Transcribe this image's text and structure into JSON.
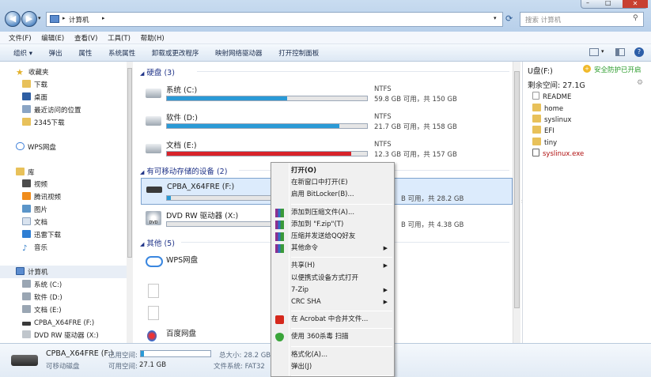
{
  "window": {
    "partial_title": "Windows...",
    "breadcrumb": "计算机",
    "search_placeholder": "搜索 计算机",
    "win_controls": [
      "–",
      "□",
      "✕"
    ]
  },
  "menubar": [
    "文件(F)",
    "编辑(E)",
    "查看(V)",
    "工具(T)",
    "帮助(H)"
  ],
  "toolbar": [
    "组织 ▾",
    "弹出",
    "属性",
    "系统属性",
    "卸载或更改程序",
    "映射网络驱动器",
    "打开控制面板"
  ],
  "nav": {
    "favorites_title": "收藏夹",
    "favorites": [
      "下载",
      "桌面",
      "最近访问的位置",
      "2345下载"
    ],
    "wps": "WPS网盘",
    "library_title": "库",
    "library": [
      "视频",
      "腾讯视频",
      "图片",
      "文档",
      "迅雷下载",
      "音乐"
    ],
    "computer_title": "计算机",
    "computer": [
      "系统 (C:)",
      "软件 (D:)",
      "文档 (E:)",
      "CPBA_X64FRE (F:)",
      "DVD RW 驱动器 (X:)"
    ]
  },
  "groups": {
    "hdd": "硬盘 (3)",
    "removable": "有可移动存储的设备 (2)",
    "other": "其他 (5)"
  },
  "drives": [
    {
      "name": "系统 (C:)",
      "fs": "NTFS",
      "space": "59.8 GB 可用，共 150 GB",
      "used": 0.6,
      "color": "#2a9ad6"
    },
    {
      "name": "软件 (D:)",
      "fs": "NTFS",
      "space": "21.7 GB 可用，共 158 GB",
      "used": 0.86,
      "color": "#2a9ad6"
    },
    {
      "name": "文档 (E:)",
      "fs": "NTFS",
      "space": "12.3 GB 可用，共 157 GB",
      "used": 0.92,
      "color": "#d8232a"
    }
  ],
  "removable": [
    {
      "name": "CPBA_X64FRE (F:)",
      "space": "B 可用，共 28.2 GB",
      "used": 0.04,
      "color": "#2a9ad6"
    },
    {
      "name": "DVD RW 驱动器 (X:)",
      "space": "B 可用，共 4.38 GB",
      "used": 1.0,
      "color": "#2a9ad6"
    }
  ],
  "other": [
    "WPS网盘",
    "",
    "",
    "百度网盘"
  ],
  "rightpane": {
    "title": "U盘(F:)",
    "protect": "安全防护已开启",
    "free": "剩余空间: 27.1G",
    "files": [
      "README",
      "home",
      "syslinux",
      "EFI",
      "tiny",
      "syslinux.exe"
    ]
  },
  "status": {
    "name": "CPBA_X64FRE (F:)",
    "used_label": "已用空间:",
    "type": "可移动磁盘",
    "free_label": "可用空间:",
    "free_val": "27.1 GB",
    "total_label": "总大小: 28.2 GB",
    "fs_label": "文件系统: FAT32",
    "used_fraction": 0.04
  },
  "context_menu": [
    {
      "label": "打开(O)",
      "bold": true
    },
    {
      "label": "在新窗口中打开(E)"
    },
    {
      "label": "启用 BitLocker(B)..."
    },
    {
      "sep": true
    },
    {
      "label": "添加到压缩文件(A)...",
      "icon": "winrar-icon"
    },
    {
      "label": "添加到 \"F.zip\"(T)",
      "icon": "winrar-icon"
    },
    {
      "label": "压缩并发送给QQ好友",
      "icon": "winrar-icon"
    },
    {
      "label": "其他命令",
      "icon": "winrar-icon",
      "sub": true
    },
    {
      "sep": true
    },
    {
      "label": "共享(H)",
      "sub": true
    },
    {
      "label": "以便携式设备方式打开"
    },
    {
      "label": "7-Zip",
      "sub": true
    },
    {
      "label": "CRC SHA",
      "sub": true
    },
    {
      "sep": true
    },
    {
      "label": "在 Acrobat 中合并文件...",
      "icon": "acrobat-icon"
    },
    {
      "sep": true
    },
    {
      "label": "使用 360杀毒 扫描",
      "icon": "shield-360-icon"
    },
    {
      "sep": true
    },
    {
      "label": "格式化(A)..."
    },
    {
      "label": "弹出(J)"
    },
    {
      "sep": true
    },
    {
      "label": "使用 360强力删除",
      "icon": "shield-360-icon"
    }
  ]
}
